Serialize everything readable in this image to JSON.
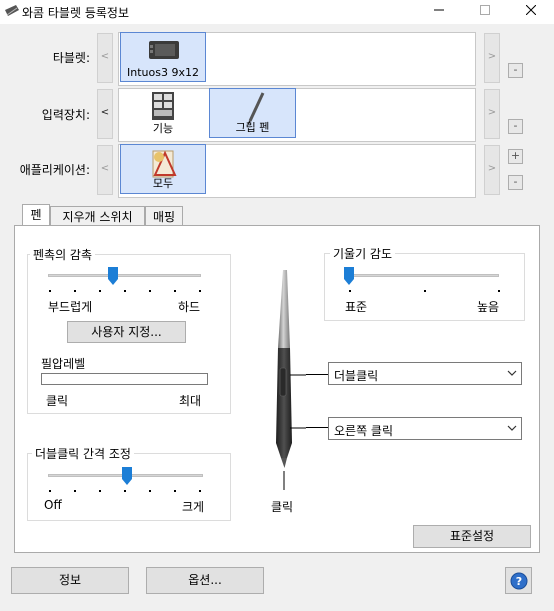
{
  "window": {
    "title": "와콤 타블렛 등록정보",
    "minimize_icon": "minimize-icon",
    "maximize_icon": "maximize-icon",
    "close_icon": "close-icon"
  },
  "rows": {
    "tablet": {
      "label": "타블렛:",
      "item_label": "Intuos3 9x12",
      "left_arrow": "<",
      "right_arrow": ">",
      "remove": "-"
    },
    "input_device": {
      "label": "입력장치:",
      "items": [
        "기능",
        "그립 펜"
      ],
      "left_arrow": "<",
      "right_arrow": ">",
      "remove": "-"
    },
    "application": {
      "label": "애플리케이션:",
      "item_label": "모두",
      "left_arrow": "<",
      "right_arrow": ">",
      "add": "+",
      "remove": "-"
    }
  },
  "tabs": [
    "펜",
    "지우개 스위치",
    "매핑"
  ],
  "active_tab": "펜",
  "tip_feel": {
    "title": "펜촉의 감촉",
    "min_label": "부드럽게",
    "max_label": "하드",
    "level": 0.42,
    "custom_button": "사용자 지정...",
    "pressure_title": "필압레벨",
    "pressure_min": "클릭",
    "pressure_max": "최대"
  },
  "tilt": {
    "title": "기울기 감도",
    "min_label": "표준",
    "max_label": "높음",
    "level": 0.0
  },
  "double_click": {
    "title": "더블클릭 간격 조정",
    "min_label": "Off",
    "max_label": "크게",
    "level": 0.51
  },
  "pen_buttons": {
    "upper": "더블클릭",
    "lower": "오른쪽 클릭",
    "tip": "클릭"
  },
  "default_button": "표준설정",
  "footer": {
    "about": "정보",
    "options": "옵션...",
    "help_icon": "help-icon"
  }
}
